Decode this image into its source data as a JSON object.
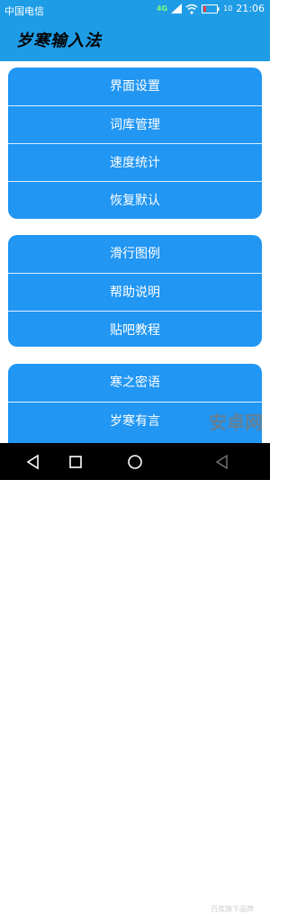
{
  "status_bar": {
    "carrier": "中国电信",
    "network": "4G",
    "battery": "10",
    "time": "21:06"
  },
  "header": {
    "title": "岁寒输入法"
  },
  "groups": [
    {
      "items": [
        {
          "label": "界面设置"
        },
        {
          "label": "词库管理"
        },
        {
          "label": "速度统计"
        },
        {
          "label": "恢复默认"
        }
      ]
    },
    {
      "items": [
        {
          "label": "滑行图例"
        },
        {
          "label": "帮助说明"
        },
        {
          "label": "贴吧教程"
        }
      ]
    },
    {
      "items": [
        {
          "label": "寒之密语"
        },
        {
          "label": "岁寒有言"
        }
      ]
    }
  ],
  "watermark": {
    "logo_text": "安卓网",
    "sub_text": "百度旗下品牌"
  },
  "colors": {
    "accent": "#2196f3",
    "status_bar": "#1e9ce6"
  },
  "icons": {
    "back": "back-triangle-icon",
    "home": "home-circle-icon",
    "recent": "recent-square-icon"
  }
}
